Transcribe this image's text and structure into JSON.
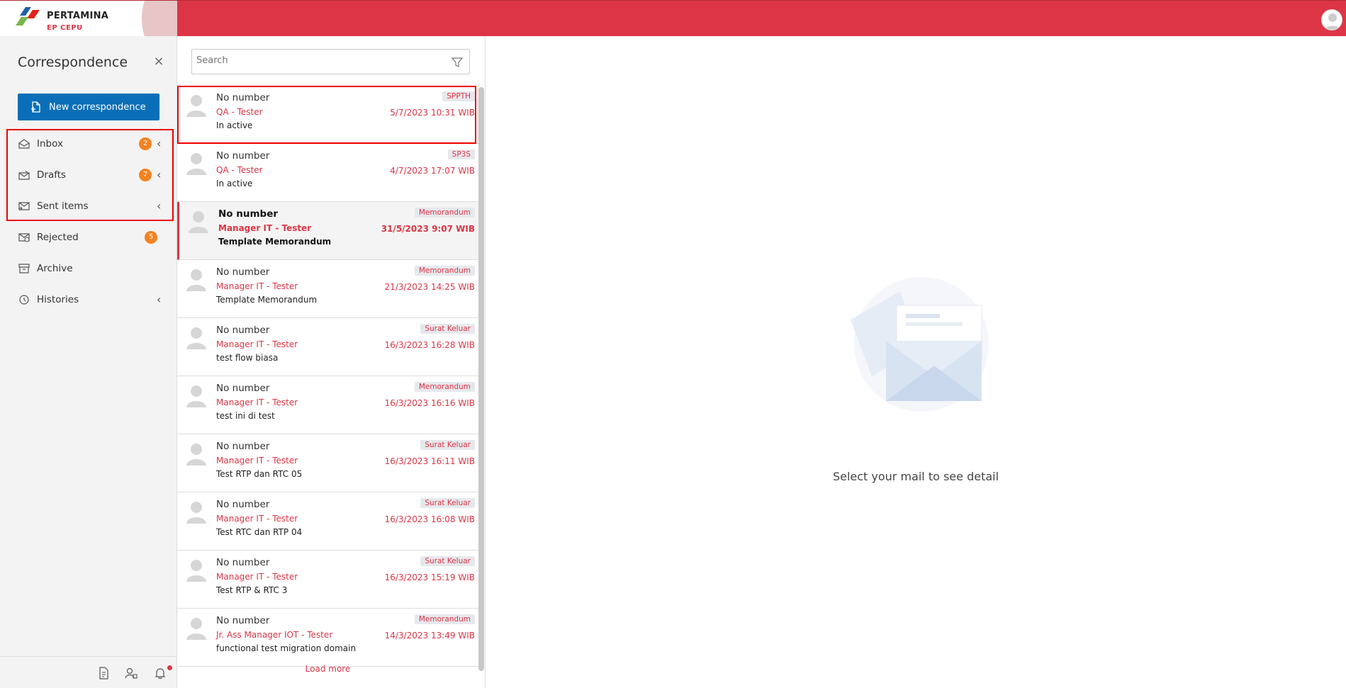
{
  "brand": {
    "name": "PERTAMINA",
    "sub": "EP CEPU"
  },
  "sidebar": {
    "title": "Correspondence",
    "new_button": "New correspondence",
    "items": [
      {
        "label": "Inbox",
        "icon": "inbox-icon",
        "badge": "2",
        "chevron": true
      },
      {
        "label": "Drafts",
        "icon": "drafts-icon",
        "badge": "7",
        "chevron": true
      },
      {
        "label": "Sent items",
        "icon": "sent-icon",
        "badge": "",
        "chevron": true
      },
      {
        "label": "Rejected",
        "icon": "rejected-icon",
        "badge": "5",
        "chevron": false
      },
      {
        "label": "Archive",
        "icon": "archive-icon",
        "badge": "",
        "chevron": false
      },
      {
        "label": "Histories",
        "icon": "history-icon",
        "badge": "",
        "chevron": true
      }
    ]
  },
  "list": {
    "search_placeholder": "Search",
    "items": [
      {
        "number": "No number",
        "sender": "QA - Tester",
        "subject": "In active",
        "tag": "SPPTH",
        "date": "5/7/2023 10:31 WIB",
        "bold": false,
        "active": false,
        "highlighted": true
      },
      {
        "number": "No number",
        "sender": "QA - Tester",
        "subject": "In active",
        "tag": "SP3S",
        "date": "4/7/2023 17:07 WIB",
        "bold": false,
        "active": false,
        "highlighted": false
      },
      {
        "number": "No number",
        "sender": "Manager IT - Tester",
        "subject": "Template Memorandum",
        "tag": "Memorandum",
        "date": "31/5/2023 9:07 WIB",
        "bold": true,
        "active": true,
        "highlighted": false
      },
      {
        "number": "No number",
        "sender": "Manager IT - Tester",
        "subject": "Template Memorandum",
        "tag": "Memorandum",
        "date": "21/3/2023 14:25 WIB",
        "bold": false,
        "active": false,
        "highlighted": false
      },
      {
        "number": "No number",
        "sender": "Manager IT - Tester",
        "subject": "test flow biasa",
        "tag": "Surat Keluar",
        "date": "16/3/2023 16:28 WIB",
        "bold": false,
        "active": false,
        "highlighted": false
      },
      {
        "number": "No number",
        "sender": "Manager IT - Tester",
        "subject": "test ini di test",
        "tag": "Memorandum",
        "date": "16/3/2023 16:16 WIB",
        "bold": false,
        "active": false,
        "highlighted": false
      },
      {
        "number": "No number",
        "sender": "Manager IT - Tester",
        "subject": "Test RTP dan RTC 05",
        "tag": "Surat Keluar",
        "date": "16/3/2023 16:11 WIB",
        "bold": false,
        "active": false,
        "highlighted": false
      },
      {
        "number": "No number",
        "sender": "Manager IT - Tester",
        "subject": "Test RTC dan RTP 04",
        "tag": "Surat Keluar",
        "date": "16/3/2023 16:08 WIB",
        "bold": false,
        "active": false,
        "highlighted": false
      },
      {
        "number": "No number",
        "sender": "Manager IT - Tester",
        "subject": "Test RTP & RTC 3",
        "tag": "Surat Keluar",
        "date": "16/3/2023 15:19 WIB",
        "bold": false,
        "active": false,
        "highlighted": false
      },
      {
        "number": "No number",
        "sender": "Jr. Ass Manager IOT - Tester",
        "subject": "functional test migration domain",
        "tag": "Memorandum",
        "date": "14/3/2023 13:49 WIB",
        "bold": false,
        "active": false,
        "highlighted": false
      }
    ],
    "load_more": "Load more"
  },
  "detail": {
    "empty_text": "Select your mail to see detail"
  },
  "colors": {
    "brand_red": "#dc3545",
    "primary_blue": "#0a6fb8",
    "badge_orange": "#f58220"
  }
}
